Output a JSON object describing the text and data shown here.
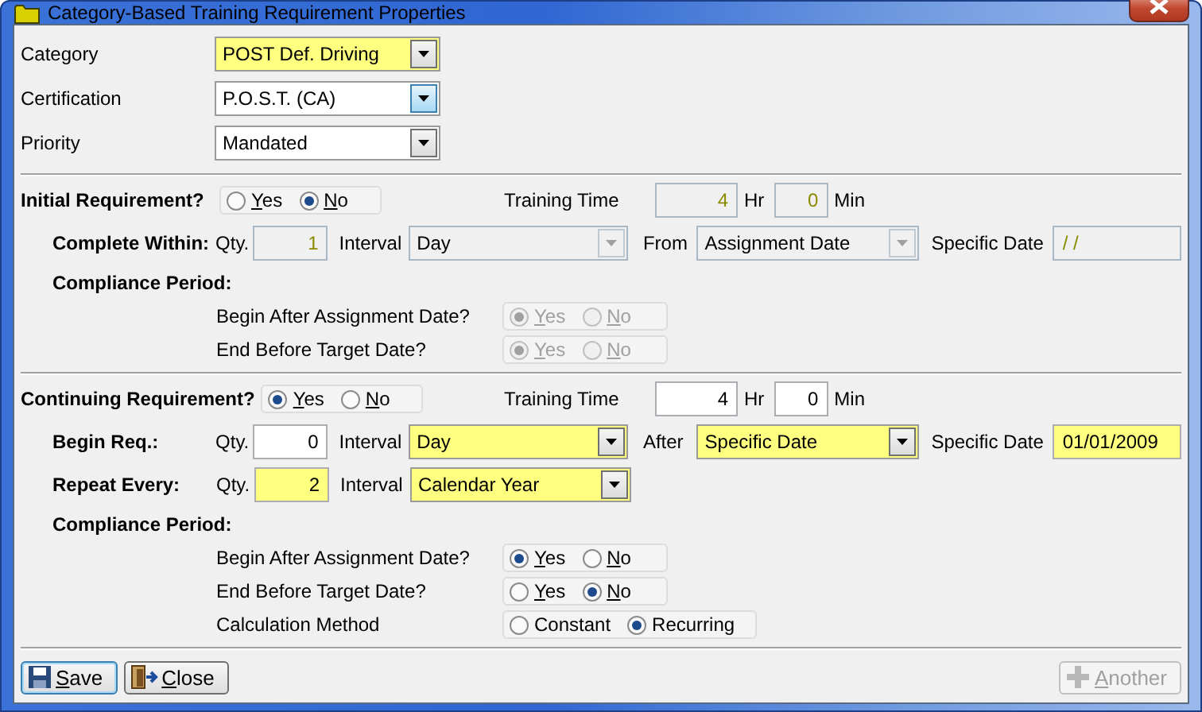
{
  "window": {
    "title": "Category-Based Training Requirement Properties"
  },
  "top_fields": [
    {
      "label": "Category",
      "value": "POST Def. Driving",
      "required": true,
      "focused": false
    },
    {
      "label": "Certification",
      "value": "P.O.S.T. (CA)",
      "required": false,
      "focused": true
    },
    {
      "label": "Priority",
      "value": "Mandated",
      "required": false,
      "focused": false
    }
  ],
  "sections": [
    {
      "label": "Initial Requirement?",
      "options": [
        {
          "label": "Yes",
          "selected": false,
          "mnemonic": true
        },
        {
          "label": "No",
          "selected": true,
          "mnemonic": true
        }
      ],
      "training_time": {
        "label": "Training Time",
        "hours": {
          "value": "4",
          "disabled": true
        },
        "hours_unit": "Hr",
        "minutes": {
          "value": "0",
          "disabled": true
        },
        "minutes_unit": "Min"
      },
      "rows": [
        {
          "label": "Complete Within:",
          "qty_label": "Qty.",
          "qty": {
            "value": "1",
            "disabled": true,
            "required": false
          },
          "interval_label": "Interval",
          "interval": {
            "value": "Day",
            "disabled": true,
            "required": false
          },
          "after_label": "From",
          "after": {
            "value": "Assignment Date",
            "disabled": true,
            "required": false
          },
          "date_label": "Specific Date",
          "date": {
            "value": "/ /",
            "disabled": true,
            "required": false
          }
        }
      ],
      "compliance": {
        "title": "Compliance Period:",
        "questions": [
          {
            "label": "Begin After Assignment Date?",
            "disabled": true,
            "options": [
              {
                "label": "Yes",
                "selected": true,
                "mnemonic": true
              },
              {
                "label": "No",
                "selected": false,
                "mnemonic": true
              }
            ]
          },
          {
            "label": "End Before Target Date?",
            "disabled": true,
            "options": [
              {
                "label": "Yes",
                "selected": true,
                "mnemonic": true
              },
              {
                "label": "No",
                "selected": false,
                "mnemonic": true
              }
            ]
          }
        ]
      }
    },
    {
      "label": "Continuing Requirement?",
      "options": [
        {
          "label": "Yes",
          "selected": true,
          "mnemonic": true
        },
        {
          "label": "No",
          "selected": false,
          "mnemonic": true
        }
      ],
      "training_time": {
        "label": "Training Time",
        "hours": {
          "value": "4",
          "disabled": false
        },
        "hours_unit": "Hr",
        "minutes": {
          "value": "0",
          "disabled": false
        },
        "minutes_unit": "Min"
      },
      "rows": [
        {
          "label": "Begin Req.:",
          "qty_label": "Qty.",
          "qty": {
            "value": "0",
            "disabled": false,
            "required": false
          },
          "interval_label": "Interval",
          "interval": {
            "value": "Day",
            "disabled": false,
            "required": true
          },
          "after_label": "After",
          "after": {
            "value": "Specific Date",
            "disabled": false,
            "required": true
          },
          "date_label": "Specific Date",
          "date": {
            "value": "01/01/2009",
            "disabled": false,
            "required": true
          }
        },
        {
          "label": "Repeat Every:",
          "qty_label": "Qty.",
          "qty": {
            "value": "2",
            "disabled": false,
            "required": true
          },
          "interval_label": "Interval",
          "interval": {
            "value": "Calendar Year",
            "disabled": false,
            "required": true
          }
        }
      ],
      "compliance": {
        "title": "Compliance Period:",
        "questions": [
          {
            "label": "Begin After Assignment Date?",
            "disabled": false,
            "options": [
              {
                "label": "Yes",
                "selected": true,
                "mnemonic": true
              },
              {
                "label": "No",
                "selected": false,
                "mnemonic": true
              }
            ]
          },
          {
            "label": "End Before Target Date?",
            "disabled": false,
            "options": [
              {
                "label": "Yes",
                "selected": false,
                "mnemonic": true
              },
              {
                "label": "No",
                "selected": true,
                "mnemonic": true
              }
            ]
          },
          {
            "label": "Calculation Method",
            "disabled": false,
            "options": [
              {
                "label": "Constant",
                "selected": false,
                "mnemonic": false
              },
              {
                "label": "Recurring",
                "selected": true,
                "mnemonic": false
              }
            ]
          }
        ]
      }
    }
  ],
  "buttons": [
    {
      "label": "Save",
      "kind": "save",
      "focused": true,
      "disabled": false
    },
    {
      "label": "Close",
      "kind": "close",
      "focused": false,
      "disabled": false
    },
    {
      "label": "Another",
      "kind": "add",
      "focused": false,
      "disabled": true
    }
  ]
}
